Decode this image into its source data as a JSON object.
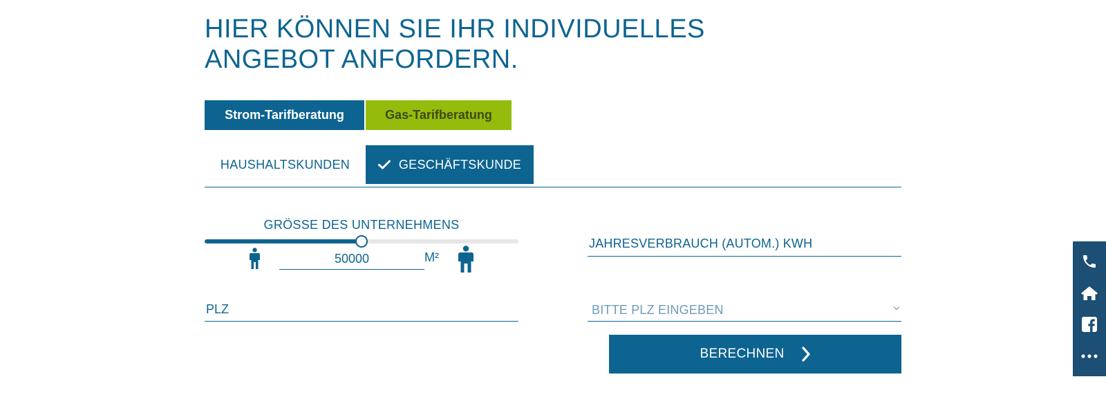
{
  "heading": {
    "title": "HIER KÖNNEN SIE IHR INDIVIDUELLES ANGEBOT ANFORDERN."
  },
  "tariff_buttons": {
    "strom": "Strom-Tarifberatung",
    "gas": "Gas-Tarifberatung"
  },
  "customer_tabs": {
    "haushalt": "HAUSHALTSKUNDEN",
    "geschaeft": "GESCHÄFTSKUNDE",
    "active": "geschaeft"
  },
  "company_size": {
    "label": "GRÖSSE DES UNTERNEHMENS",
    "value": "50000",
    "unit": "M²",
    "slider_fraction": 0.5
  },
  "consumption": {
    "label": "JAHRESVERBRAUCH (AUTOM.) KWH"
  },
  "plz": {
    "label": "PLZ",
    "select_placeholder": "BITTE PLZ EINGEBEN"
  },
  "calculate_button": {
    "label": "BERECHNEN"
  },
  "side_toolbar": {
    "icons": [
      "phone-icon",
      "home-icon",
      "facebook-icon",
      "more-icon"
    ]
  },
  "colors": {
    "primary": "#0d6491",
    "accent_green": "#95bb0c",
    "toolbar": "#1d4e74",
    "placeholder": "#6d9cb8"
  }
}
